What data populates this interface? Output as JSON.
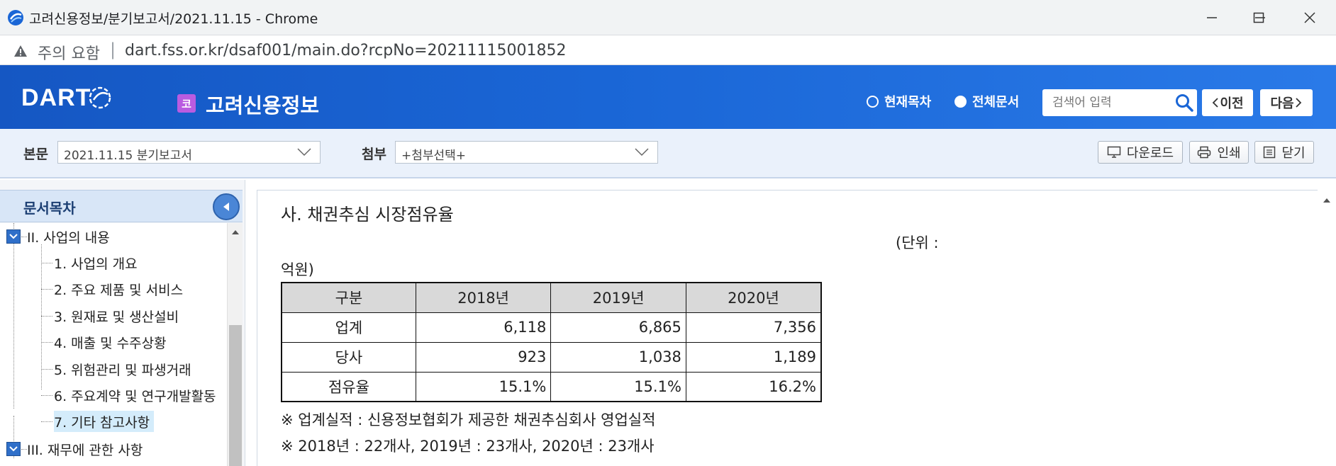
{
  "browser": {
    "window_title": "고려신용정보/분기보고서/2021.11.15 - Chrome",
    "security_label": "주의 요함",
    "url": "dart.fss.or.kr/dsaf001/main.do?rcpNo=20211115001852"
  },
  "header": {
    "logo_text": "DART",
    "company_badge": "코",
    "company_name": "고려신용정보",
    "radio_current": "현재목차",
    "radio_all": "전체문서",
    "search_placeholder": "검색어 입력",
    "prev_label": "이전",
    "next_label": "다음"
  },
  "toolbar": {
    "main_label": "본문",
    "main_select_value": "2021.11.15  분기보고서",
    "attach_label": "첨부",
    "attach_select_value": "+첨부선택+",
    "download_label": "다운로드",
    "print_label": "인쇄",
    "close_label": "닫기"
  },
  "toc": {
    "title": "문서목차",
    "section_ii": "II. 사업의 내용",
    "items": [
      "1. 사업의 개요",
      "2. 주요 제품 및 서비스",
      "3. 원재료 및 생산설비",
      "4. 매출 및 수주상황",
      "5. 위험관리 및 파생거래",
      "6. 주요계약 및 연구개발활동",
      "7. 기타 참고사항"
    ],
    "selected_index": 6,
    "section_iii": "III. 재무에 관한 사항"
  },
  "document": {
    "section_title": "사. 채권추심 시장점유율",
    "unit_line1": "(단위 :",
    "unit_line2": "억원)",
    "table": {
      "headers": [
        "구분",
        "2018년",
        "2019년",
        "2020년"
      ],
      "rows": [
        [
          "업계",
          "6,118",
          "6,865",
          "7,356"
        ],
        [
          "당사",
          "923",
          "1,038",
          "1,189"
        ],
        [
          "점유율",
          "15.1%",
          "15.1%",
          "16.2%"
        ]
      ]
    },
    "note1": "※ 업계실적 : 신용정보협회가 제공한 채권추심회사 영업실적",
    "note2": "※ 2018년 : 22개사, 2019년 : 23개사, 2020년 : 23개사"
  },
  "colors": {
    "header_blue": "#1a66d6",
    "badge_purple": "#b95ce0",
    "toolbar_bg": "#eaf1fb",
    "selected_item_bg": "#d4ecfb"
  }
}
